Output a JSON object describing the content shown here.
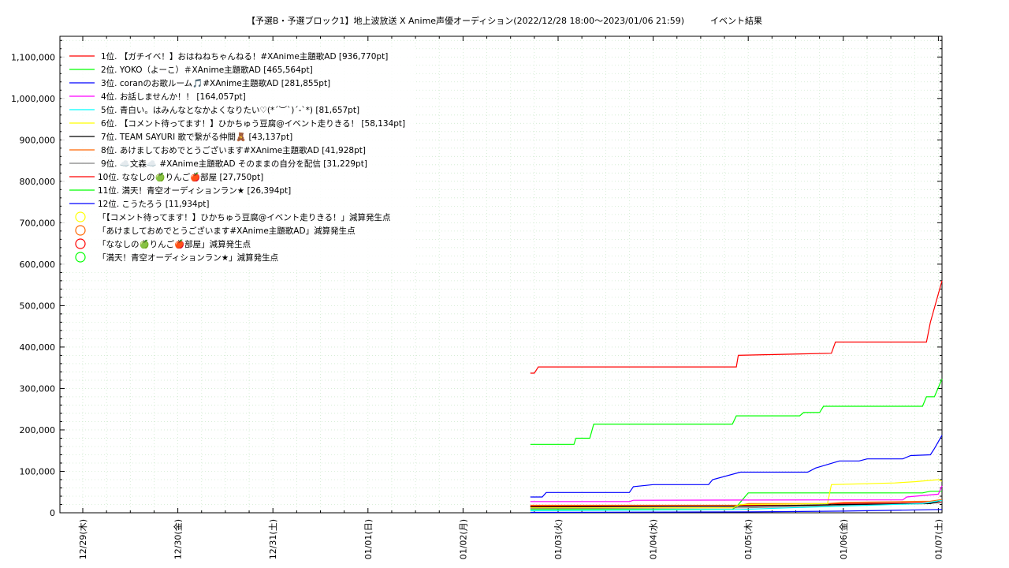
{
  "chart_data": {
    "type": "line",
    "title": "【予選B・予選ブロック1】地上波放送 X Anime声優オーディション(2022/12/28 18:00～2023/01/06 21:59)　　　イベント結果",
    "xlabel": "",
    "ylabel": "",
    "ylim": [
      0,
      1150000
    ],
    "xlim": [
      "2022-12-28 18:00",
      "2023-01-07 02:00"
    ],
    "x_tick_labels": [
      "12/29(木)",
      "12/30(金)",
      "12/31(土)",
      "01/01(日)",
      "01/02(月)",
      "01/03(火)",
      "01/04(水)",
      "01/05(木)",
      "01/06(金)",
      "01/07(土)"
    ],
    "y_tick_labels": [
      "0",
      "100,000",
      "200,000",
      "300,000",
      "400,000",
      "500,000",
      "600,000",
      "700,000",
      "800,000",
      "900,000",
      "1,000,000",
      "1,100,000"
    ],
    "y_ticks": [
      0,
      100000,
      200000,
      300000,
      400000,
      500000,
      600000,
      700000,
      800000,
      900000,
      1000000,
      1100000
    ],
    "grid": true,
    "legend_position": "top-left",
    "series": [
      {
        "name": "1位. 【ガチイベ！】おはねねちゃんねる！#XAnime主題歌AD [936,770pt]",
        "color": "#ff0000",
        "points": [
          [
            "2023-01-02 17:00",
            337000
          ],
          [
            "2023-01-02 18:00",
            337000
          ],
          [
            "2023-01-02 19:00",
            352000
          ],
          [
            "2023-01-04 21:00",
            352000
          ],
          [
            "2023-01-04 21:30",
            380000
          ],
          [
            "2023-01-05 21:00",
            385000
          ],
          [
            "2023-01-05 22:00",
            412000
          ],
          [
            "2023-01-06 21:00",
            412000
          ],
          [
            "2023-01-06 22:00",
            460000
          ],
          [
            "2023-01-07 01:30",
            560000
          ]
        ]
      },
      {
        "name": "2位. YOKO（よーこ）＃XAnime主題歌AD [465,564pt]",
        "color": "#00ff00",
        "points": [
          [
            "2023-01-02 17:00",
            165000
          ],
          [
            "2023-01-03 04:00",
            165000
          ],
          [
            "2023-01-03 04:30",
            180000
          ],
          [
            "2023-01-03 08:00",
            180000
          ],
          [
            "2023-01-03 09:00",
            214000
          ],
          [
            "2023-01-04 20:00",
            214000
          ],
          [
            "2023-01-04 21:00",
            234000
          ],
          [
            "2023-01-05 13:00",
            234000
          ],
          [
            "2023-01-05 14:00",
            242000
          ],
          [
            "2023-01-05 18:00",
            242000
          ],
          [
            "2023-01-05 19:00",
            257000
          ],
          [
            "2023-01-06 20:00",
            257000
          ],
          [
            "2023-01-06 21:00",
            280000
          ],
          [
            "2023-01-06 23:00",
            280000
          ],
          [
            "2023-01-07 01:30",
            323000
          ]
        ]
      },
      {
        "name": "3位. coranのお歌ルーム🎵#XAnime主題歌AD [281,855pt]",
        "color": "#0000ff",
        "points": [
          [
            "2023-01-02 17:00",
            38000
          ],
          [
            "2023-01-02 20:00",
            38000
          ],
          [
            "2023-01-02 21:00",
            49000
          ],
          [
            "2023-01-03 18:00",
            49000
          ],
          [
            "2023-01-03 19:00",
            63000
          ],
          [
            "2023-01-04 00:00",
            68000
          ],
          [
            "2023-01-04 14:00",
            68000
          ],
          [
            "2023-01-04 15:00",
            80000
          ],
          [
            "2023-01-04 22:00",
            98000
          ],
          [
            "2023-01-05 15:00",
            98000
          ],
          [
            "2023-01-05 17:00",
            108000
          ],
          [
            "2023-01-05 23:00",
            125000
          ],
          [
            "2023-01-06 04:00",
            125000
          ],
          [
            "2023-01-06 06:00",
            130000
          ],
          [
            "2023-01-06 15:00",
            130000
          ],
          [
            "2023-01-06 17:00",
            138000
          ],
          [
            "2023-01-06 22:00",
            140000
          ],
          [
            "2023-01-06 23:00",
            155000
          ],
          [
            "2023-01-07 01:30",
            187000
          ]
        ]
      },
      {
        "name": "4位. お話しませんか！！ [164,057pt]",
        "color": "#ff00ff",
        "points": [
          [
            "2023-01-02 17:00",
            27000
          ],
          [
            "2023-01-03 18:00",
            27000
          ],
          [
            "2023-01-03 19:00",
            30000
          ],
          [
            "2023-01-05 22:00",
            31000
          ],
          [
            "2023-01-06 15:00",
            31000
          ],
          [
            "2023-01-06 16:00",
            38000
          ],
          [
            "2023-01-07 00:00",
            45000
          ],
          [
            "2023-01-07 01:30",
            65000
          ]
        ]
      },
      {
        "name": "5位. 青白い。はみんなとなかよくなりたい♡(*´︶`)´-`*) [81,657pt]",
        "color": "#00ffff",
        "points": [
          [
            "2023-01-02 17:00",
            5000
          ],
          [
            "2023-01-04 22:00",
            8000
          ],
          [
            "2023-01-05 20:00",
            15000
          ],
          [
            "2023-01-06 20:00",
            22000
          ],
          [
            "2023-01-07 01:30",
            30000
          ]
        ]
      },
      {
        "name": "6位. 【コメント待ってます！】ひかちゅう豆腐@イベント走りきる！ [58,134pt]",
        "color": "#ffff00",
        "points": [
          [
            "2023-01-02 17:00",
            12000
          ],
          [
            "2023-01-04 20:00",
            12000
          ],
          [
            "2023-01-04 22:00",
            20000
          ],
          [
            "2023-01-05 20:00",
            22000
          ],
          [
            "2023-01-05 21:00",
            68000
          ],
          [
            "2023-01-06 13:00",
            72000
          ],
          [
            "2023-01-06 18:00",
            75000
          ],
          [
            "2023-01-07 00:00",
            80000
          ],
          [
            "2023-01-07 01:30",
            76000
          ]
        ]
      },
      {
        "name": "7位. TEAM SAYURI 歌で繋がる仲間🧸 [43,137pt]",
        "color": "#000000",
        "points": [
          [
            "2023-01-02 17:00",
            14000
          ],
          [
            "2023-01-05 00:00",
            16000
          ],
          [
            "2023-01-06 00:00",
            20000
          ],
          [
            "2023-01-06 22:00",
            22000
          ],
          [
            "2023-01-07 01:30",
            30000
          ]
        ]
      },
      {
        "name": "8位. あけましておめでとうございます#XAnime主題歌AD [41,928pt]",
        "color": "#ff6600",
        "points": [
          [
            "2023-01-02 17:00",
            18000
          ],
          [
            "2023-01-04 22:00",
            18000
          ],
          [
            "2023-01-05 00:00",
            22000
          ],
          [
            "2023-01-05 20:00",
            22000
          ],
          [
            "2023-01-06 00:00",
            25000
          ],
          [
            "2023-01-06 22:00",
            28000
          ],
          [
            "2023-01-07 01:30",
            32000
          ]
        ]
      },
      {
        "name": "9位. ☁️文森☁️ #XAnime主題歌AD そのままの自分を配信 [31,229pt]",
        "color": "#808080",
        "points": [
          [
            "2023-01-02 17:00",
            10000
          ],
          [
            "2023-01-05 00:00",
            12000
          ],
          [
            "2023-01-06 00:00",
            18000
          ],
          [
            "2023-01-07 01:30",
            24000
          ]
        ]
      },
      {
        "name": "10位. ななしの🍏りんご🍎部屋 [27,750pt]",
        "color": "#ff0000",
        "points": [
          [
            "2023-01-02 17:00",
            16000
          ],
          [
            "2023-01-04 20:00",
            16000
          ],
          [
            "2023-01-04 22:00",
            18000
          ],
          [
            "2023-01-05 20:00",
            18000
          ],
          [
            "2023-01-05 21:00",
            22000
          ],
          [
            "2023-01-07 01:30",
            25000
          ]
        ]
      },
      {
        "name": "11位. 満天！青空オーディションラン★ [26,394pt]",
        "color": "#00ff00",
        "points": [
          [
            "2023-01-02 17:00",
            8000
          ],
          [
            "2023-01-04 20:00",
            8000
          ],
          [
            "2023-01-04 21:00",
            14000
          ],
          [
            "2023-01-05 00:00",
            48000
          ],
          [
            "2023-01-06 20:00",
            48000
          ],
          [
            "2023-01-06 22:00",
            52000
          ],
          [
            "2023-01-07 01:30",
            52000
          ]
        ]
      },
      {
        "name": "12位. こうたろう [11,934pt]",
        "color": "#0000ff",
        "points": [
          [
            "2023-01-02 17:00",
            1000
          ],
          [
            "2023-01-05 00:00",
            2000
          ],
          [
            "2023-01-06 00:00",
            4000
          ],
          [
            "2023-01-07 01:30",
            8000
          ]
        ]
      }
    ],
    "deduction_markers": [
      {
        "name": "「【コメント待ってます！】ひかちゅう豆腐@イベント走りきる！」減算発生点",
        "color": "#ffff00"
      },
      {
        "name": "「あけましておめでとうございます#XAnime主題歌AD」減算発生点",
        "color": "#ff6600"
      },
      {
        "name": "「ななしの🍏りんご🍎部屋」減算発生点",
        "color": "#ff0000"
      },
      {
        "name": "「満天！青空オーディションラン★」減算発生点",
        "color": "#00ff00"
      }
    ]
  }
}
